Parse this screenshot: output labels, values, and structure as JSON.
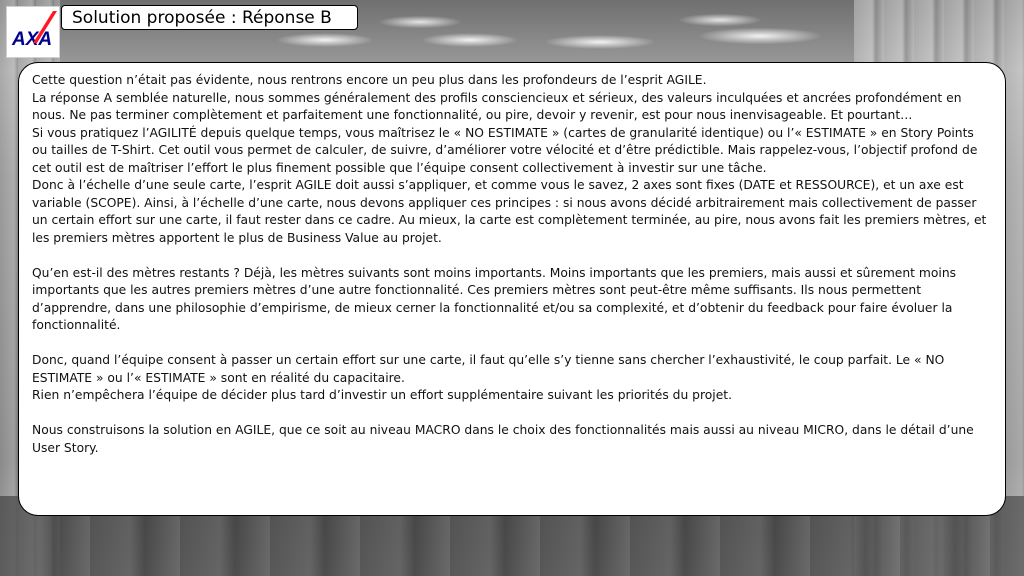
{
  "slide": {
    "title": "Solution proposée : Réponse B",
    "logo": {
      "text": "AXA",
      "brand_color": "#00008F",
      "accent_color": "#FF1721"
    }
  },
  "content": {
    "paragraphs": [
      "Cette question n’était pas évidente, nous rentrons encore un peu plus dans les profondeurs de l’esprit AGILE.",
      "La réponse A semblée naturelle, nous sommes généralement des profils consciencieux et sérieux, des valeurs inculquées et ancrées profondément en nous. Ne pas terminer complètement et parfaitement une fonctionnalité, ou pire, devoir y revenir, est pour nous inenvisageable. Et pourtant…",
      "Si vous pratiquez l’AGILITÉ depuis quelque temps, vous maîtrisez le « NO ESTIMATE » (cartes de granularité identique) ou l’« ESTIMATE » en Story Points ou tailles de T-Shirt. Cet outil vous permet de calculer, de suivre, d’améliorer votre vélocité et d’être prédictible. Mais rappelez-vous, l’objectif profond de cet outil est de maîtriser l’effort le plus finement possible que l’équipe consent collectivement à investir sur une tâche.",
      "Donc à l’échelle d’une seule carte, l’esprit AGILE doit aussi s’appliquer, et comme vous le savez, 2 axes sont fixes (DATE et RESSOURCE), et un axe est variable (SCOPE). Ainsi, à l’échelle d’une carte, nous devons appliquer ces principes : si nous avons décidé arbitrairement mais collectivement de passer un certain effort sur une carte, il faut rester dans ce cadre. Au mieux, la carte est complètement terminée, au pire, nous avons fait les premiers mètres, et les premiers mètres apportent le plus de Business Value au projet.",
      "",
      "Qu’en est-il des mètres restants ? Déjà, les mètres suivants sont moins importants. Moins importants que les premiers, mais aussi et sûrement moins importants que les autres premiers mètres d’une autre fonctionnalité. Ces premiers mètres sont peut-être même suffisants. Ils nous permettent d’apprendre, dans une philosophie d’empirisme, de mieux cerner la fonctionnalité et/ou sa complexité, et d’obtenir du feedback pour faire évoluer la fonctionnalité.",
      "",
      "Donc, quand l’équipe consent à passer un certain effort sur une carte, il faut qu’elle s’y tienne sans chercher l’exhaustivité, le coup parfait. Le « NO ESTIMATE » ou l’« ESTIMATE » sont en réalité du capacitaire.",
      "Rien n’empêchera l’équipe de décider plus tard d’investir un effort supplémentaire suivant les priorités du projet.",
      "",
      "Nous construisons la solution en AGILE, que ce soit au niveau MACRO dans le choix des fonctionnalités mais aussi au niveau MICRO, dans le détail d’une User Story."
    ]
  }
}
